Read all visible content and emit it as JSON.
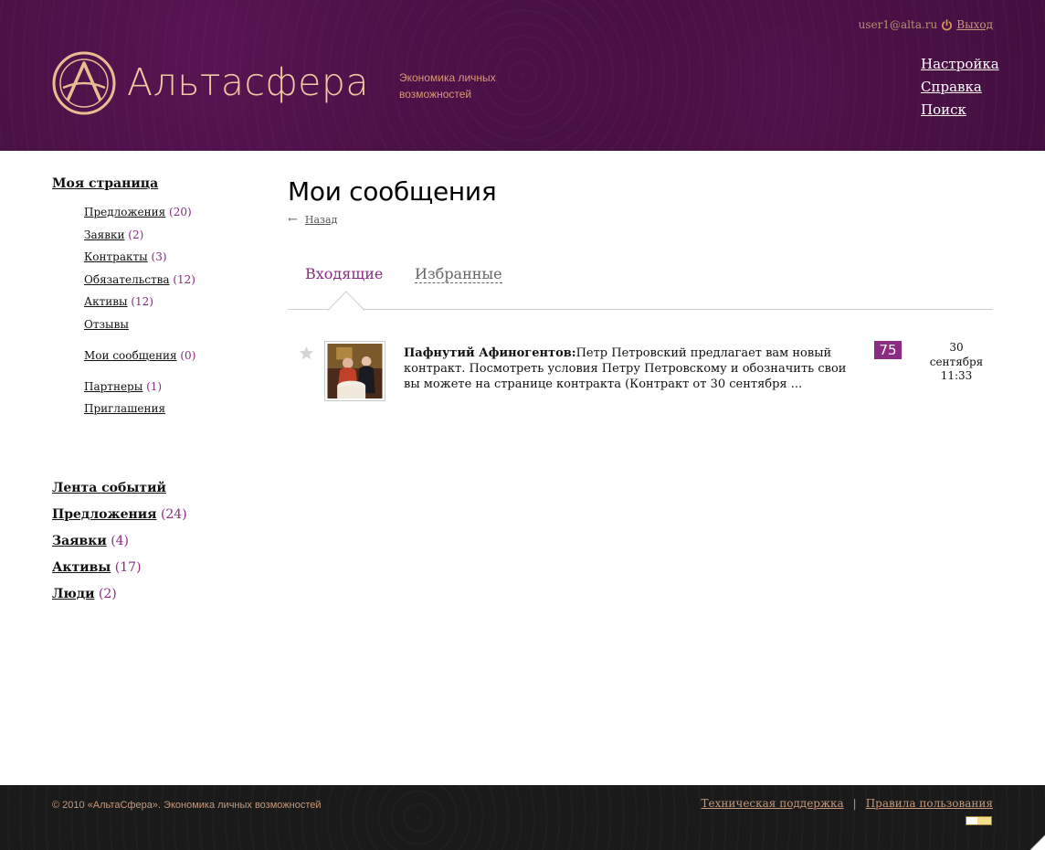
{
  "header": {
    "brand": "Альтасфера",
    "slogan": "Экономика личных возможностей",
    "user_email": "user1@alta.ru",
    "logout_label": "Выход",
    "nav": [
      {
        "label": "Настройка"
      },
      {
        "label": "Справка"
      },
      {
        "label": "Поиск"
      }
    ]
  },
  "sidebar": {
    "my_page_label": "Моя страница",
    "sub_items": [
      {
        "label": "Предложения",
        "count": "(20)"
      },
      {
        "label": "Заявки",
        "count": "(2)"
      },
      {
        "label": "Контракты",
        "count": "(3)"
      },
      {
        "label": "Обязательства",
        "count": "(12)"
      },
      {
        "label": "Активы",
        "count": "(12)"
      },
      {
        "label": "Отзывы",
        "count": ""
      },
      {
        "label": "Мои сообщения",
        "count": "(0)"
      },
      {
        "label": "Партнеры",
        "count": "(1)"
      },
      {
        "label": "Приглашения",
        "count": ""
      }
    ],
    "main_items": [
      {
        "label": "Лента событий",
        "count": ""
      },
      {
        "label": "Предложения",
        "count": "(24)"
      },
      {
        "label": "Заявки",
        "count": "(4)"
      },
      {
        "label": "Активы",
        "count": "(17)"
      },
      {
        "label": "Люди",
        "count": "(2)"
      }
    ]
  },
  "main": {
    "title": "Мои сообщения",
    "back_label": "Назад",
    "tabs": [
      {
        "label": "Входящие",
        "active": true
      },
      {
        "label": "Избранные",
        "active": false
      }
    ],
    "messages": [
      {
        "author": "Пафнутий Афиногентов:",
        "text": "Петр Петровский предлагает вам новый контракт. Посмотреть условия Петру Петровскому и обозначить свои вы можете на странице контракта (Контракт от 30 сентября ...",
        "rating": "75",
        "date_day": "30",
        "date_month": "сентября",
        "date_time": "11:33"
      }
    ]
  },
  "footer": {
    "copyright": "© 2010 «АльтаСфера». Экономика личных возможностей",
    "support_link": "Техническая поддержка",
    "separator": "|",
    "rules_link": "Правила пользования"
  },
  "colors": {
    "accent": "#8b2b83",
    "header_bg": "#3d0d3a",
    "brand_text": "#f0c9a0",
    "footer_bg": "#1a1a1a",
    "footer_text": "#c99878"
  }
}
